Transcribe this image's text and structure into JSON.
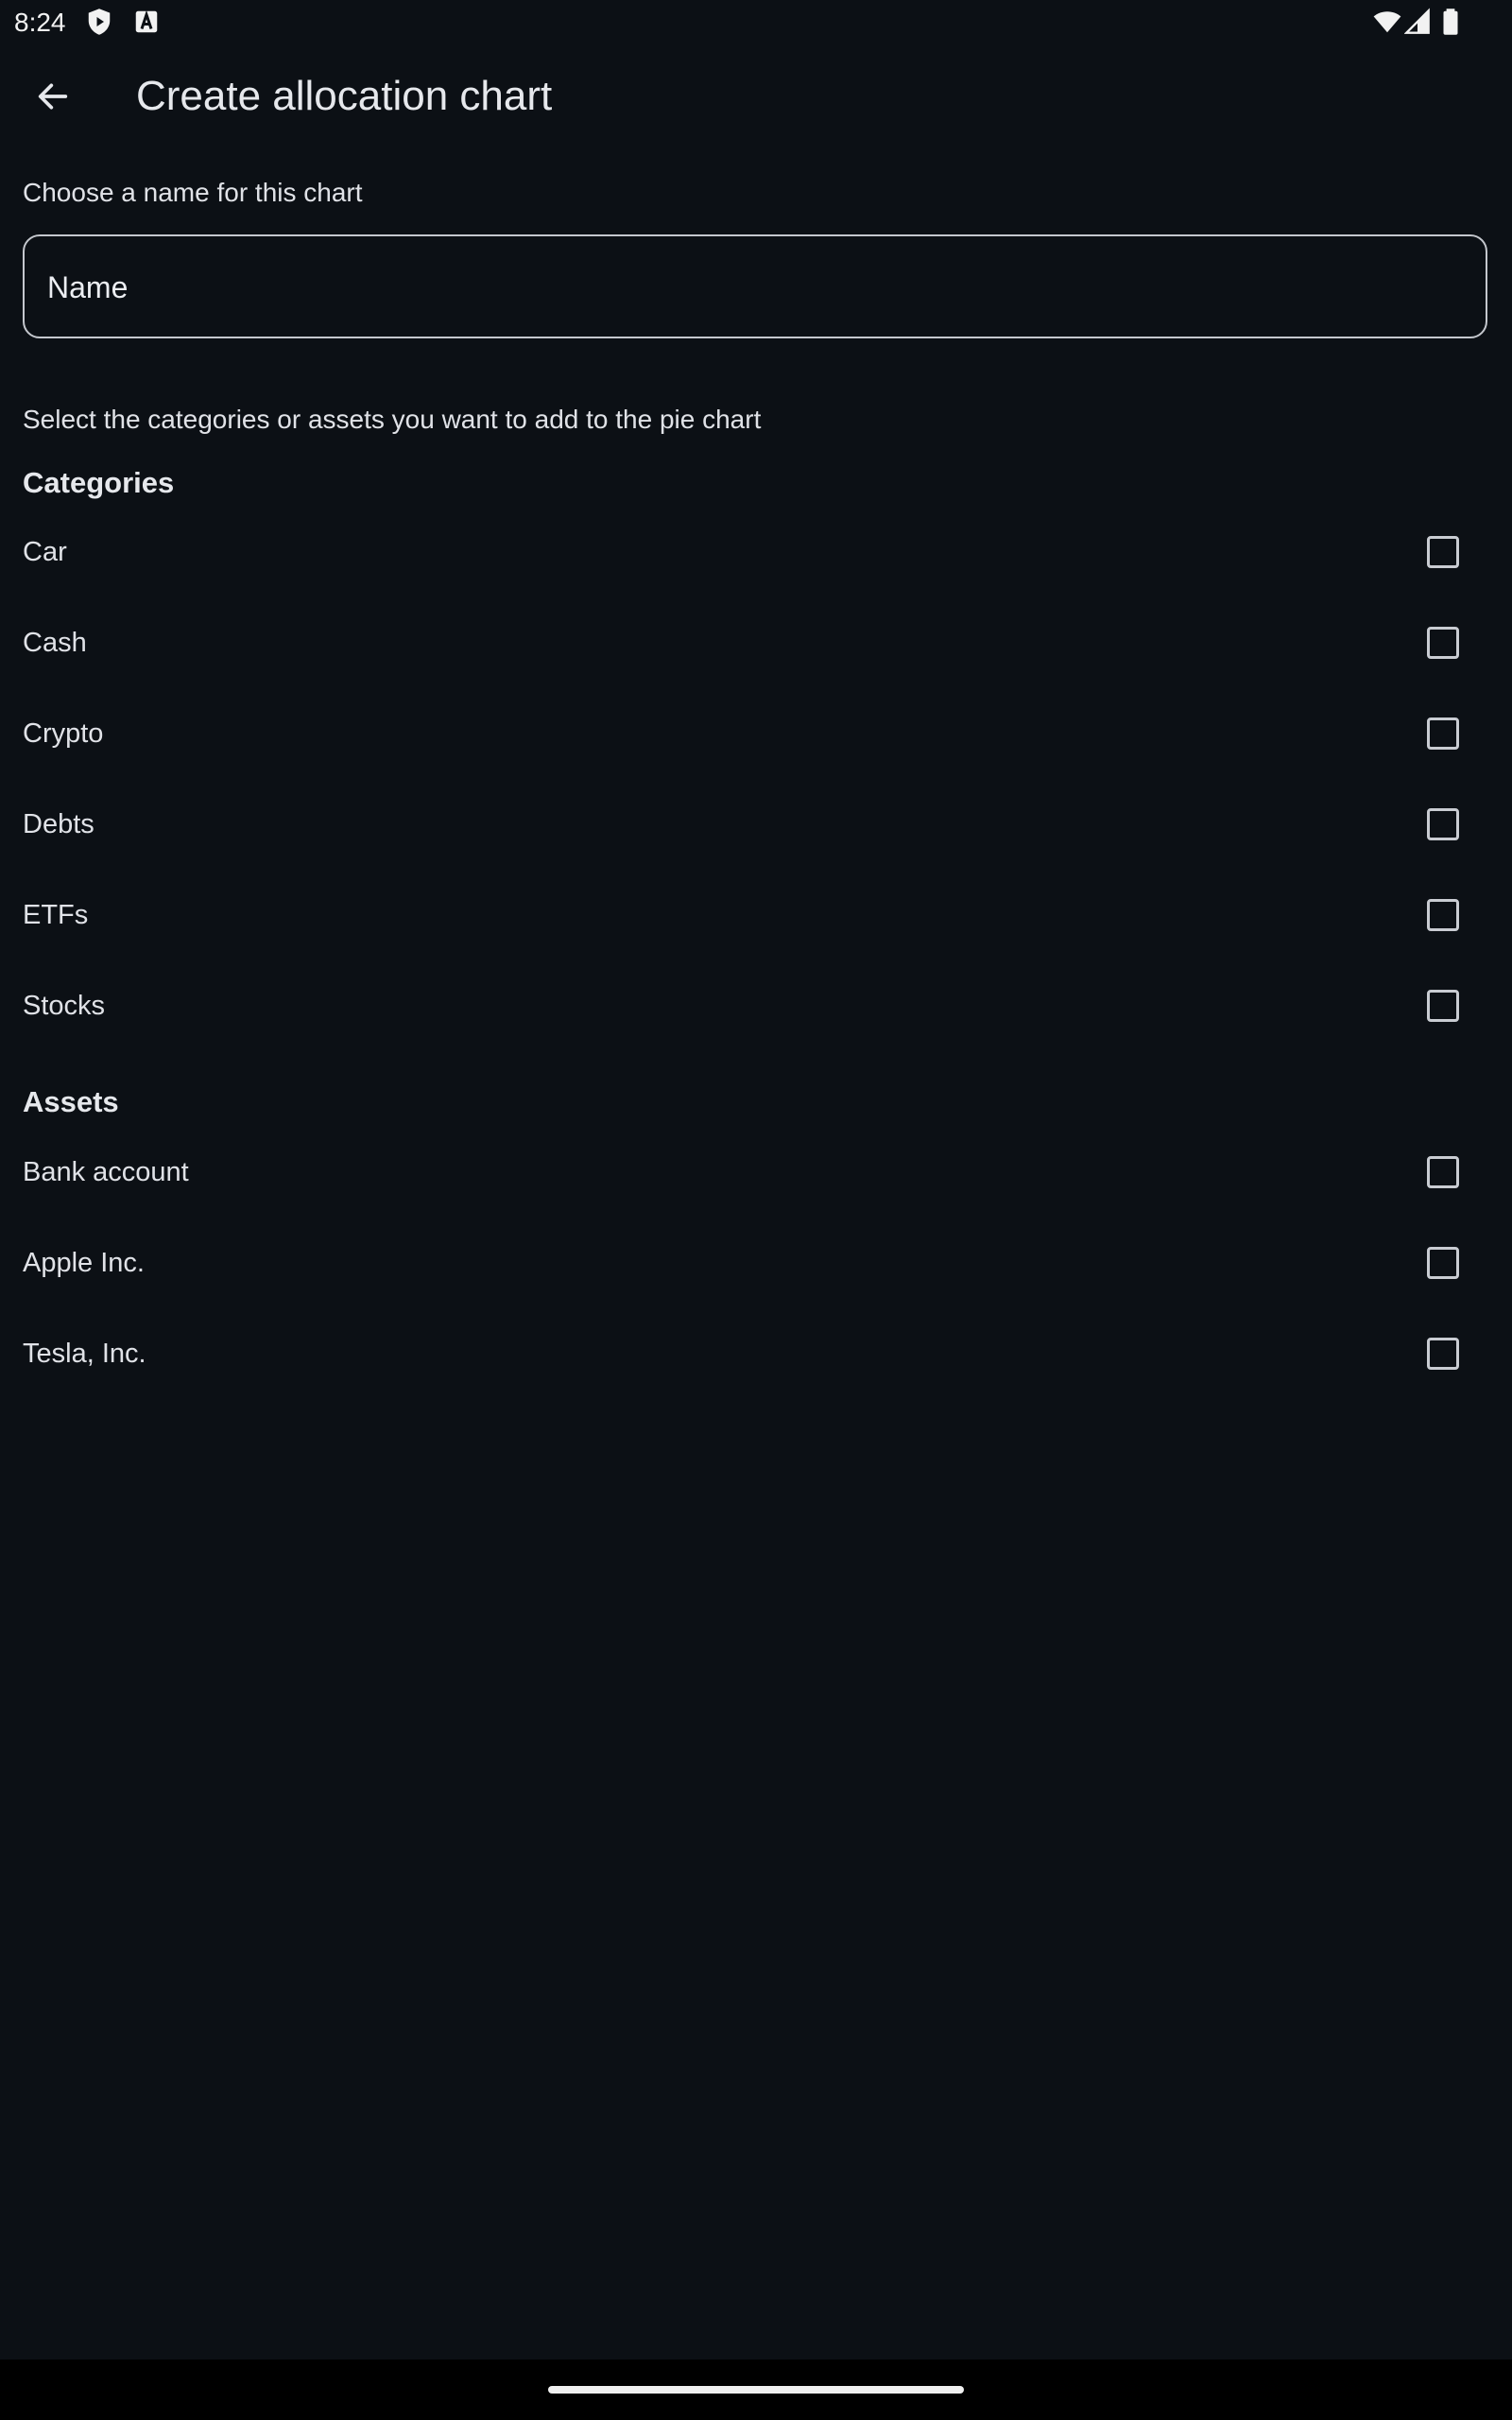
{
  "status_bar": {
    "time": "8:24",
    "left_icons": [
      "shield-play-icon",
      "text-a-icon"
    ],
    "right_icons": [
      "wifi-icon",
      "cell-signal-icon",
      "battery-icon"
    ]
  },
  "app_bar": {
    "back_icon": "arrow-back-icon",
    "title": "Create allocation chart"
  },
  "form": {
    "name_prompt": "Choose a name for this chart",
    "name_placeholder": "Name",
    "name_value": "",
    "select_prompt": "Select the categories or assets you want to add to the pie chart"
  },
  "categories": {
    "title": "Categories",
    "items": [
      {
        "label": "Car",
        "checked": false
      },
      {
        "label": "Cash",
        "checked": false
      },
      {
        "label": "Crypto",
        "checked": false
      },
      {
        "label": "Debts",
        "checked": false
      },
      {
        "label": "ETFs",
        "checked": false
      },
      {
        "label": "Stocks",
        "checked": false
      }
    ]
  },
  "assets": {
    "title": "Assets",
    "items": [
      {
        "label": "Bank account",
        "checked": false
      },
      {
        "label": "Apple Inc.",
        "checked": false
      },
      {
        "label": "Tesla, Inc.",
        "checked": false
      }
    ]
  },
  "colors": {
    "background": "#0c1015",
    "text": "#e3e5ea",
    "outline": "#c4c7cd"
  }
}
